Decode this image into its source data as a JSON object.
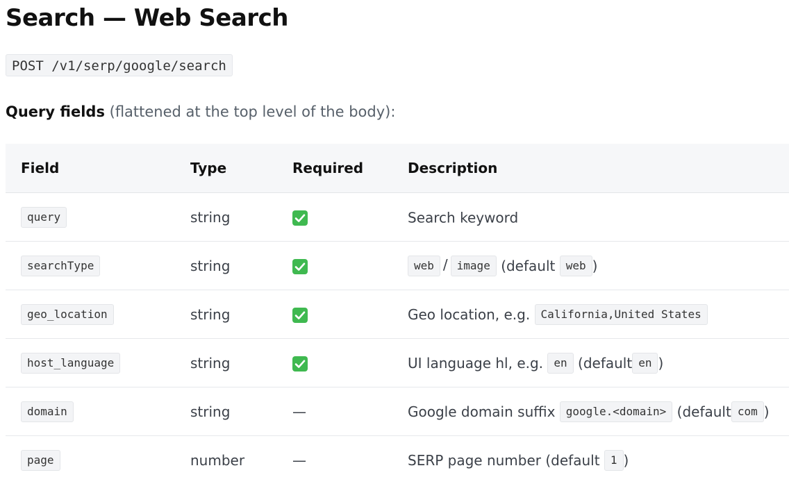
{
  "page": {
    "title": "Search — Web Search",
    "endpoint": "POST /v1/serp/google/search",
    "subheading_bold": "Query fields",
    "subheading_rest": " (flattened at the top level of the body):"
  },
  "table": {
    "headers": {
      "field": "Field",
      "type": "Type",
      "required": "Required",
      "description": "Description"
    },
    "rows": [
      {
        "field": "query",
        "type": "string",
        "required": true,
        "desc": {
          "text": "Search keyword"
        }
      },
      {
        "field": "searchType",
        "type": "string",
        "required": true,
        "desc": {
          "code1": "web",
          "sep": "/",
          "code2": "image",
          "mid": "(default",
          "code3": "web",
          "end": ")"
        }
      },
      {
        "field": "geo_location",
        "type": "string",
        "required": true,
        "desc": {
          "text": "Geo location, e.g.",
          "code1": "California,United States"
        }
      },
      {
        "field": "host_language",
        "type": "string",
        "required": true,
        "desc": {
          "text": "UI language hl, e.g.",
          "code1": "en",
          "mid": "(default",
          "code2": "en",
          "end": ")"
        }
      },
      {
        "field": "domain",
        "type": "string",
        "required": false,
        "required_text": "—",
        "desc": {
          "text": "Google domain suffix",
          "code1": "google.<domain>",
          "mid": "(default",
          "code2": "com",
          "end": ")"
        }
      },
      {
        "field": "page",
        "type": "number",
        "required": false,
        "required_text": "—",
        "desc": {
          "text": "SERP page number (default",
          "code1": "1",
          "end": ")"
        }
      }
    ]
  },
  "icons": {
    "required_check": "check-box-icon"
  },
  "colors": {
    "check_green": "#3fb950",
    "code_bg": "#f3f4f6",
    "header_bg": "#f6f7f9"
  }
}
